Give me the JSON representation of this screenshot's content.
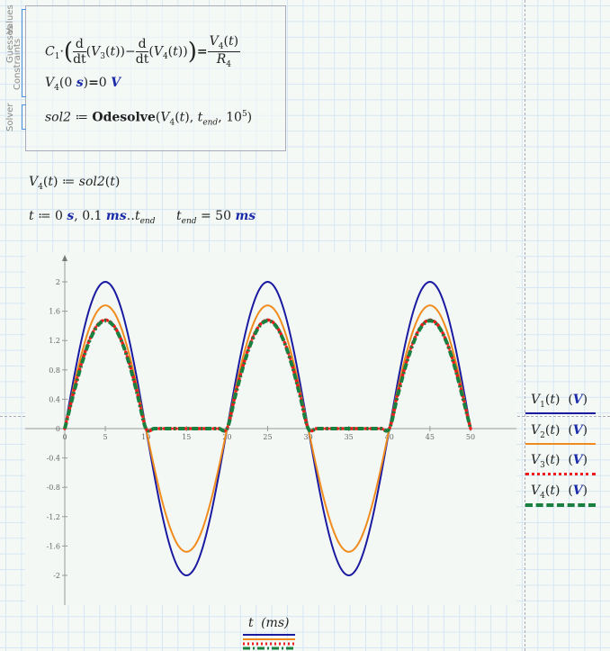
{
  "solve_block": {
    "labels": [
      "Values",
      "Guesses",
      "Constraints",
      "Solver"
    ],
    "equation": {
      "c": "C",
      "c_sub": "1",
      "d": "d",
      "dt": "dt",
      "v3": "V",
      "v3_sub": "3",
      "v4": "V",
      "v4_sub": "4",
      "t": "t",
      "r": "R",
      "r_sub": "4"
    },
    "initial": {
      "lhs": "V",
      "sub": "4",
      "arg": "0",
      "unit_s": "s",
      "rhs": "0",
      "unit_v": "V"
    },
    "solver": {
      "name": "sol2",
      "fn": "Odesolve",
      "arg1": "V",
      "arg1_sub": "4",
      "tend": "t",
      "tend_sub": "end",
      "steps": "10",
      "steps_exp": "5"
    }
  },
  "defs": {
    "v4_def": {
      "lhs": "V",
      "sub": "4",
      "rhs": "sol2"
    },
    "t_range": {
      "var": "t",
      "start": "0",
      "unit_s": "s",
      "step": "0.1",
      "unit_ms": "ms",
      "end": "t",
      "end_sub": "end"
    },
    "t_end": {
      "var": "t",
      "sub": "end",
      "value": "50",
      "unit": "ms"
    }
  },
  "chart_data": {
    "type": "line",
    "xlabel": "t (ms)",
    "xlabel_var": "t",
    "xlabel_unit": "ms",
    "xlim": [
      0,
      50
    ],
    "ylim": [
      -2,
      2
    ],
    "xticks": [
      "0",
      "5",
      "10",
      "15",
      "20",
      "25",
      "30",
      "35",
      "40",
      "45",
      "50"
    ],
    "yticks": [
      "2",
      "1.6",
      "1.2",
      "0.8",
      "0.4",
      "0",
      "-0.4",
      "-0.8",
      "-1.2",
      "-1.6",
      "-2"
    ],
    "x_step": 1,
    "series": [
      {
        "name": "V1(t) (V)",
        "var": "V",
        "sub": "1",
        "unit": "V",
        "color": "#1a1aa0",
        "style": "solid",
        "values": [
          0,
          0.618,
          1.176,
          1.618,
          1.902,
          2,
          1.902,
          1.618,
          1.176,
          0.618,
          0,
          -0.618,
          -1.176,
          -1.618,
          -1.902,
          -2,
          -1.902,
          -1.618,
          -1.176,
          -0.618,
          0,
          0.618,
          1.176,
          1.618,
          1.902,
          2,
          1.902,
          1.618,
          1.176,
          0.618,
          0,
          -0.618,
          -1.176,
          -1.618,
          -1.902,
          -2,
          -1.902,
          -1.618,
          -1.176,
          -0.618,
          0,
          0.618,
          1.176,
          1.618,
          1.902,
          2,
          1.902,
          1.618,
          1.176,
          0.618,
          0
        ]
      },
      {
        "name": "V2(t) (V)",
        "var": "V",
        "sub": "2",
        "unit": "V",
        "color": "#f08c1e",
        "style": "solid",
        "values": [
          0,
          0.519,
          0.988,
          1.359,
          1.598,
          1.68,
          1.598,
          1.359,
          0.988,
          0.519,
          0,
          -0.519,
          -0.988,
          -1.359,
          -1.598,
          -1.68,
          -1.598,
          -1.359,
          -0.988,
          -0.519,
          0,
          0.519,
          0.988,
          1.359,
          1.598,
          1.68,
          1.598,
          1.359,
          0.988,
          0.519,
          0,
          -0.519,
          -0.988,
          -1.359,
          -1.598,
          -1.68,
          -1.598,
          -1.359,
          -0.988,
          -0.519,
          0,
          0.519,
          0.988,
          1.359,
          1.598,
          1.68,
          1.598,
          1.359,
          0.988,
          0.519,
          0
        ]
      },
      {
        "name": "V3(t) (V)",
        "var": "V",
        "sub": "3",
        "unit": "V",
        "color": "#ee1c1c",
        "style": "dotted",
        "values": [
          0,
          0.457,
          0.87,
          1.197,
          1.408,
          1.48,
          1.408,
          1.197,
          0.87,
          0.457,
          0,
          0,
          0,
          0,
          0,
          0,
          0,
          0,
          0,
          0,
          0,
          0.457,
          0.87,
          1.197,
          1.408,
          1.48,
          1.408,
          1.197,
          0.87,
          0.457,
          0,
          0,
          0,
          0,
          0,
          0,
          0,
          0,
          0,
          0,
          0,
          0.457,
          0.87,
          1.197,
          1.408,
          1.48,
          1.408,
          1.197,
          0.87,
          0.457,
          0
        ]
      },
      {
        "name": "V4(t) (V)",
        "var": "V",
        "sub": "4",
        "unit": "V",
        "color": "#1a8040",
        "style": "dashdot",
        "values": [
          0,
          0.44,
          0.85,
          1.18,
          1.395,
          1.47,
          1.4,
          1.19,
          0.86,
          0.44,
          0,
          0,
          0,
          0,
          0,
          0,
          0,
          0,
          0,
          0,
          0,
          0.44,
          0.85,
          1.18,
          1.395,
          1.47,
          1.4,
          1.19,
          0.86,
          0.44,
          0,
          0,
          0,
          0,
          0,
          0,
          0,
          0,
          0,
          0,
          0,
          0.44,
          0.85,
          1.18,
          1.395,
          1.47,
          1.4,
          1.19,
          0.86,
          0.44,
          0
        ]
      }
    ]
  }
}
